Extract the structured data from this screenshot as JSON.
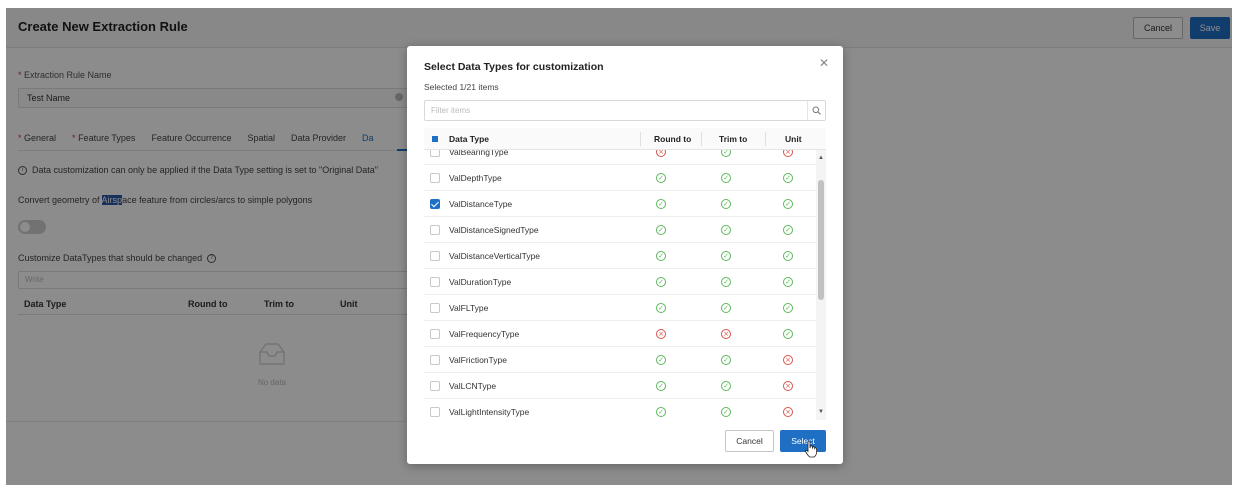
{
  "page": {
    "title": "Create New Extraction Rule",
    "cancel_label": "Cancel",
    "save_label": "Save",
    "name_label": "Extraction Rule Name",
    "name_value": "Test Name",
    "tabs": [
      "General",
      "Feature Types",
      "Feature Occurrence",
      "Spatial",
      "Data Provider",
      "Da"
    ],
    "info_text": "Data customization can only be applied if the Data Type setting is set to \"Original Data\"",
    "convert_pre": "Convert geometry of ",
    "convert_hl": "Airsp",
    "convert_post": "ace feature from circles/arcs to simple polygons",
    "customize_label": "Customize DataTypes that should be changed",
    "write_placeholder": "Write",
    "table_headers": [
      "Data Type",
      "Round to",
      "Trim to",
      "Unit"
    ],
    "no_data": "No data"
  },
  "modal": {
    "title": "Select Data Types for customization",
    "subtitle": "Selected 1/21 items",
    "filter_placeholder": "Filter items",
    "headers": [
      "Data Type",
      "Round to",
      "Trim to",
      "Unit"
    ],
    "rows": [
      {
        "name": "ValBearingType",
        "checked": false,
        "round": "no",
        "trim": "ok",
        "unit": "no"
      },
      {
        "name": "ValDepthType",
        "checked": false,
        "round": "ok",
        "trim": "ok",
        "unit": "ok"
      },
      {
        "name": "ValDistanceType",
        "checked": true,
        "round": "ok",
        "trim": "ok",
        "unit": "ok"
      },
      {
        "name": "ValDistanceSignedType",
        "checked": false,
        "round": "ok",
        "trim": "ok",
        "unit": "ok"
      },
      {
        "name": "ValDistanceVerticalType",
        "checked": false,
        "round": "ok",
        "trim": "ok",
        "unit": "ok"
      },
      {
        "name": "ValDurationType",
        "checked": false,
        "round": "ok",
        "trim": "ok",
        "unit": "ok"
      },
      {
        "name": "ValFLType",
        "checked": false,
        "round": "ok",
        "trim": "ok",
        "unit": "ok"
      },
      {
        "name": "ValFrequencyType",
        "checked": false,
        "round": "no",
        "trim": "no",
        "unit": "ok"
      },
      {
        "name": "ValFrictionType",
        "checked": false,
        "round": "ok",
        "trim": "ok",
        "unit": "no"
      },
      {
        "name": "ValLCNType",
        "checked": false,
        "round": "ok",
        "trim": "ok",
        "unit": "no"
      },
      {
        "name": "ValLightIntensityType",
        "checked": false,
        "round": "ok",
        "trim": "ok",
        "unit": "no"
      }
    ],
    "cancel_label": "Cancel",
    "select_label": "Select"
  },
  "colors": {
    "accent": "#1f6fc5",
    "ok": "#5cb85c",
    "error": "#d9534f"
  }
}
